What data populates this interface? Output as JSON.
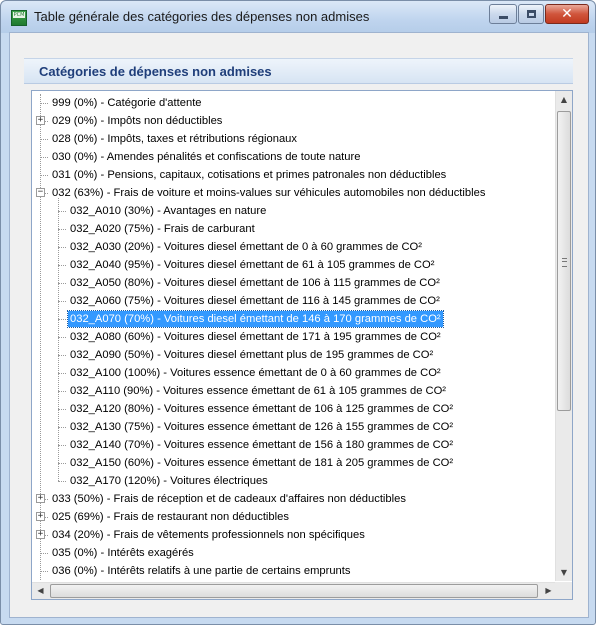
{
  "window": {
    "title": "Table générale des catégories des dépenses non admises",
    "app_icon_text": "PCM"
  },
  "header": {
    "title": "Catégories de dépenses non admises"
  },
  "tree": {
    "selected_index": 12,
    "items": [
      {
        "label": "999 (0%) - Catégorie d'attente",
        "level": 0,
        "expander": "none"
      },
      {
        "label": "029 (0%) - Impôts non déductibles",
        "level": 0,
        "expander": "collapsed"
      },
      {
        "label": "028 (0%) - Impôts, taxes et rétributions régionaux",
        "level": 0,
        "expander": "none"
      },
      {
        "label": "030 (0%) - Amendes pénalités et confiscations de toute nature",
        "level": 0,
        "expander": "none"
      },
      {
        "label": "031 (0%) - Pensions, capitaux, cotisations et primes patronales non déductibles",
        "level": 0,
        "expander": "none"
      },
      {
        "label": "032 (63%) - Frais de voiture et moins-values sur véhicules automobiles non déductibles",
        "level": 0,
        "expander": "expanded"
      },
      {
        "label": "032_A010 (30%) - Avantages en nature",
        "level": 1,
        "expander": "none"
      },
      {
        "label": "032_A020 (75%) - Frais de carburant",
        "level": 1,
        "expander": "none"
      },
      {
        "label": "032_A030 (20%) - Voitures diesel émettant de 0 à 60 grammes de CO²",
        "level": 1,
        "expander": "none"
      },
      {
        "label": "032_A040 (95%) - Voitures diesel émettant de 61 à 105 grammes de CO²",
        "level": 1,
        "expander": "none"
      },
      {
        "label": "032_A050 (80%) - Voitures diesel émettant de 106 à 115 grammes de CO²",
        "level": 1,
        "expander": "none"
      },
      {
        "label": "032_A060 (75%) - Voitures diesel émettant de 116 à 145 grammes de CO²",
        "level": 1,
        "expander": "none"
      },
      {
        "label": "032_A070 (70%) - Voitures diesel émettant de 146 à 170 grammes de CO²",
        "level": 1,
        "expander": "none"
      },
      {
        "label": "032_A080 (60%) - Voitures diesel émettant de 171 à 195 grammes de CO²",
        "level": 1,
        "expander": "none"
      },
      {
        "label": "032_A090 (50%) - Voitures diesel émettant plus de 195 grammes de CO²",
        "level": 1,
        "expander": "none"
      },
      {
        "label": "032_A100 (100%) - Voitures essence émettant de 0 à 60 grammes de CO²",
        "level": 1,
        "expander": "none"
      },
      {
        "label": "032_A110 (90%) - Voitures essence émettant de 61 à 105 grammes de CO²",
        "level": 1,
        "expander": "none"
      },
      {
        "label": "032_A120 (80%) - Voitures essence émettant de 106 à 125 grammes de CO²",
        "level": 1,
        "expander": "none"
      },
      {
        "label": "032_A130 (75%) - Voitures essence émettant de 126 à 155 grammes de CO²",
        "level": 1,
        "expander": "none"
      },
      {
        "label": "032_A140 (70%) - Voitures essence émettant de 156 à 180 grammes de CO²",
        "level": 1,
        "expander": "none"
      },
      {
        "label": "032_A150 (60%) - Voitures essence émettant de 181 à 205 grammes de CO²",
        "level": 1,
        "expander": "none"
      },
      {
        "label": "032_A170 (120%) - Voitures électriques",
        "level": 1,
        "expander": "none"
      },
      {
        "label": "033 (50%) - Frais de réception et de cadeaux d'affaires non déductibles",
        "level": 0,
        "expander": "collapsed"
      },
      {
        "label": "025 (69%) - Frais de restaurant non déductibles",
        "level": 0,
        "expander": "collapsed"
      },
      {
        "label": "034 (20%) - Frais de vêtements professionnels non spécifiques",
        "level": 0,
        "expander": "collapsed"
      },
      {
        "label": "035 (0%) - Intérêts exagérés",
        "level": 0,
        "expander": "none"
      },
      {
        "label": "036 (0%) - Intérêts relatifs à une partie de certains emprunts",
        "level": 0,
        "expander": "none"
      }
    ]
  },
  "icons": {
    "expand": "+",
    "collapse": "−",
    "scroll_up": "▲",
    "scroll_down": "▼",
    "scroll_left": "◀",
    "scroll_right": "▶",
    "close": "✕"
  }
}
